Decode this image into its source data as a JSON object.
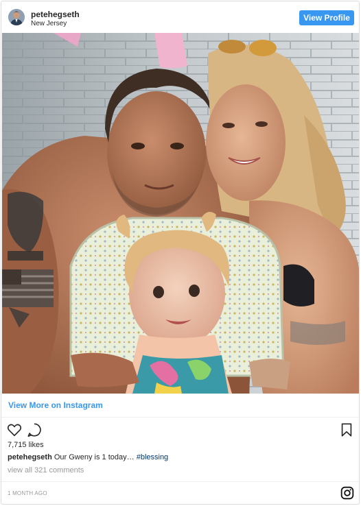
{
  "header": {
    "username": "petehegseth",
    "location": "New Jersey",
    "view_profile_label": "View Profile"
  },
  "view_more_label": "View More on Instagram",
  "likes_text": "7,715 likes",
  "caption": {
    "username": "petehegseth",
    "text": "Our Gweny is 1 today…",
    "hashtag": "#blessing"
  },
  "comments_link": "view all 321 comments",
  "timestamp": "1 MONTH AGO",
  "icons": {
    "like": "heart-outline-icon",
    "comment": "comment-bubble-icon",
    "save": "bookmark-icon",
    "brand": "instagram-glyph-icon"
  },
  "colors": {
    "accent": "#3897f0",
    "text": "#262626",
    "muted": "#999999",
    "hashtag": "#003569"
  }
}
